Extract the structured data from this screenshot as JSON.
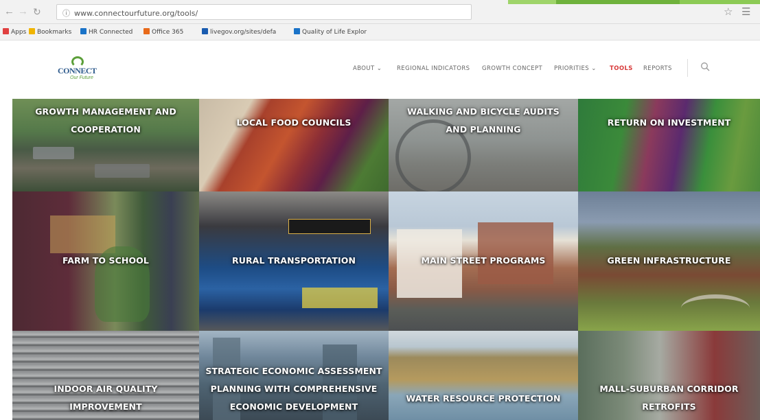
{
  "browser": {
    "url_prefix": "ⓘ",
    "url": "www.connectourfuture.org/tools/",
    "bookmarks": [
      {
        "label": "Apps",
        "color": "#e04040"
      },
      {
        "label": "Bookmarks",
        "color": "#f0b400"
      },
      {
        "label": "HR Connected",
        "color": "#1a73c8"
      },
      {
        "label": "Office 365",
        "color": "#e86a1a"
      },
      {
        "label": "livegov.org/sites/defa",
        "color": "#1a5cb0"
      },
      {
        "label": "Quality of Life Explor",
        "color": "#1a73c8"
      }
    ]
  },
  "site": {
    "logo_word": "CONNECT",
    "logo_tag": "Our Future",
    "nav": [
      {
        "label": "ABOUT ⌄"
      },
      {
        "label": "REGIONAL INDICATORS"
      },
      {
        "label": "GROWTH CONCEPT"
      },
      {
        "label": "PRIORITIES ⌄"
      },
      {
        "label": "TOOLS"
      },
      {
        "label": "REPORTS"
      }
    ]
  },
  "tiles": [
    {
      "lines": [
        "GROWTH MANAGEMENT AND",
        "COOPERATION"
      ]
    },
    {
      "lines": [
        "LOCAL FOOD COUNCILS"
      ]
    },
    {
      "lines": [
        "WALKING AND BICYCLE AUDITS",
        "AND PLANNING"
      ]
    },
    {
      "lines": [
        "RETURN ON INVESTMENT"
      ]
    },
    {
      "lines": [
        "FARM TO SCHOOL"
      ]
    },
    {
      "lines": [
        "RURAL TRANSPORTATION"
      ]
    },
    {
      "lines": [
        "MAIN STREET PROGRAMS"
      ]
    },
    {
      "lines": [
        "GREEN INFRASTRUCTURE"
      ]
    },
    {
      "lines": [
        "INDOOR AIR QUALITY",
        "IMPROVEMENT"
      ]
    },
    {
      "lines": [
        "STRATEGIC ECONOMIC ASSESSMENT",
        "PLANNING WITH COMPREHENSIVE",
        "ECONOMIC DEVELOPMENT"
      ]
    },
    {
      "lines": [
        "WATER RESOURCE PROTECTION"
      ]
    },
    {
      "lines": [
        "MALL-SUBURBAN CORRIDOR",
        "RETROFITS"
      ]
    }
  ]
}
